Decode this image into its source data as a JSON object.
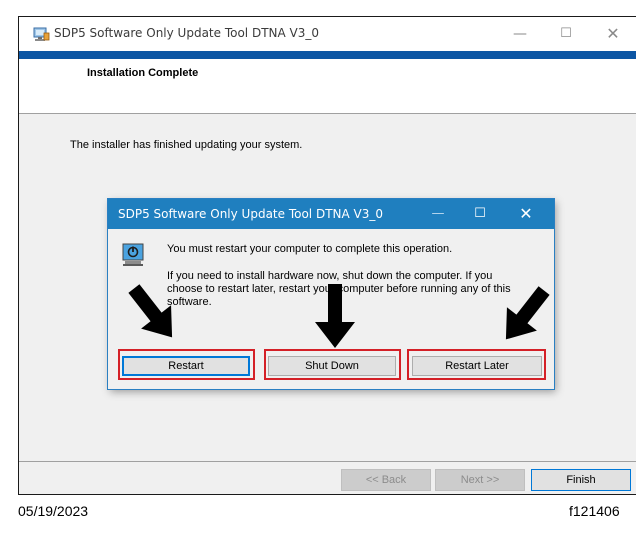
{
  "window": {
    "title": "SDP5 Software Only Update Tool DTNA V3_0",
    "icon": "installer-icon",
    "controls": {
      "minimize": "—",
      "maximize": "☐",
      "close": "✕"
    }
  },
  "wizard": {
    "heading": "Installation Complete",
    "message": "The installer has finished updating your system.",
    "buttons": {
      "back": "<< Back",
      "next": "Next >>",
      "finish": "Finish"
    }
  },
  "dialog": {
    "title": "SDP5 Software Only Update Tool DTNA V3_0",
    "icon": "power-icon",
    "line1": "You must restart your computer to complete this operation.",
    "line2": "If you need to install hardware now, shut down the computer. If you choose to restart later, restart your computer before running any of this software.",
    "buttons": {
      "restart": "Restart",
      "shut_down": "Shut Down",
      "restart_later": "Restart Later"
    },
    "controls": {
      "minimize": "—",
      "maximize": "☐",
      "close": "✕"
    }
  },
  "annotations": {
    "highlight_color": "#d42027",
    "arrow_color": "#000000"
  },
  "caption": {
    "date": "05/19/2023",
    "figure_id": "f121406"
  },
  "colors": {
    "accent": "#0c56a4",
    "dialog_titlebar": "#1f7fbf",
    "focus": "#0078d7"
  }
}
